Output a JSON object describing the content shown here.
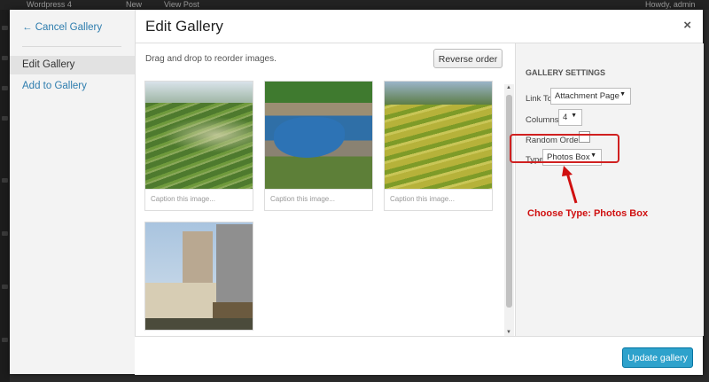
{
  "adminbar": {
    "site": "Wordpress 4",
    "new": "New",
    "view": "View Post",
    "user": "Howdy, admin"
  },
  "modal": {
    "title": "Edit Gallery",
    "close": "×",
    "menu": {
      "cancel": "← Cancel Gallery",
      "active": "Edit Gallery",
      "add": "Add to Gallery"
    },
    "hint": "Drag and drop to reorder images.",
    "reverse": "Reverse order",
    "images": [
      {
        "caption": "Caption this image..."
      },
      {
        "caption": "Caption this image..."
      },
      {
        "caption": "Caption this image..."
      },
      {
        "caption": ""
      }
    ],
    "settings": {
      "heading": "GALLERY SETTINGS",
      "link_to_label": "Link To",
      "link_to_value": "Attachment Page",
      "columns_label": "Columns",
      "columns_value": "4",
      "random_label": "Random Order",
      "type_label": "Type",
      "type_value": "Photos Box"
    },
    "annotation": "Choose Type: Photos Box",
    "update": "Update gallery"
  },
  "colors": {
    "accent": "#2ea2cc",
    "link": "#2e7dae",
    "annotation": "#d01010"
  },
  "icons": {
    "close": "close-icon",
    "dropdown": "chevron-down-icon",
    "arrow": "arrow-up-icon"
  }
}
